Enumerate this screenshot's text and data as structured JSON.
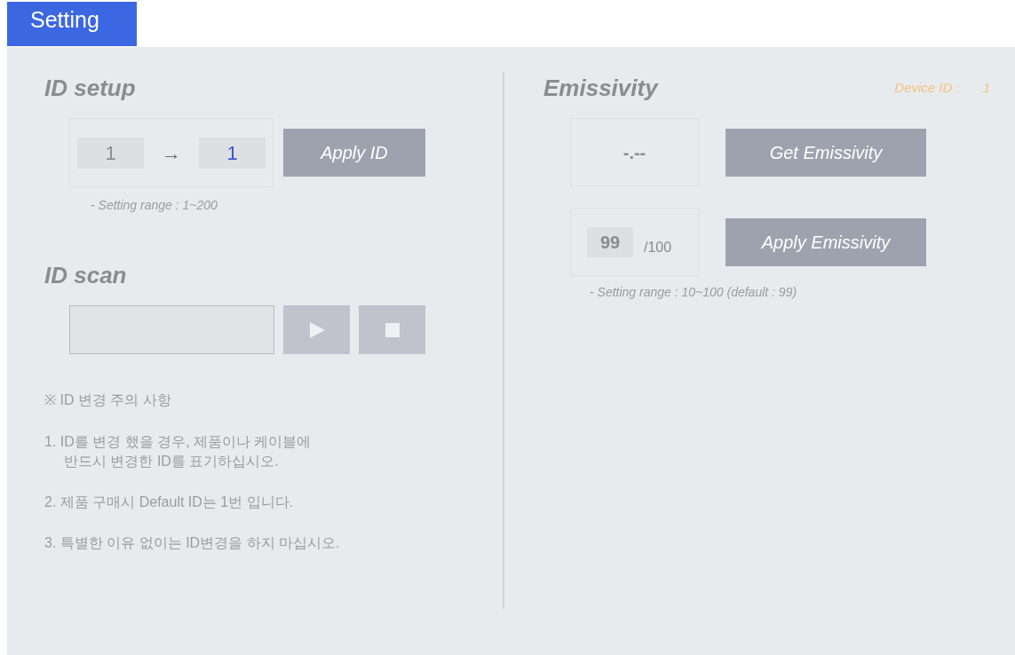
{
  "tabs": [
    {
      "label": "Setting",
      "selected": true
    }
  ],
  "id_setup": {
    "title": "ID setup",
    "current_id": "1",
    "arrow": "→",
    "new_id": "1",
    "apply_button": "Apply ID",
    "range_note": "- Setting range : 1~200"
  },
  "id_scan": {
    "title": "ID scan",
    "play_disabled": true,
    "stop_disabled": true
  },
  "notes": {
    "heading": "※ ID 변경 주의 사항",
    "items": [
      "1. ID를 변경 했을 경우, 제품이나 케이블에\n반드시 변경한 ID를 표기하십시오.",
      "2. 제품 구매시 Default ID는 1번 입니다.",
      "3. 특별한 이유 없이는 ID변경을 하지 마십시오."
    ]
  },
  "emissivity": {
    "title": "Emissivity",
    "device_id_label": "Device ID :",
    "device_id": "1",
    "reading": "-.--",
    "get_button": "Get Emissivity",
    "value": "99",
    "max": "/100",
    "apply_button": "Apply Emissivity",
    "range_note": "- Setting range : 10~100 (default : 99)"
  }
}
